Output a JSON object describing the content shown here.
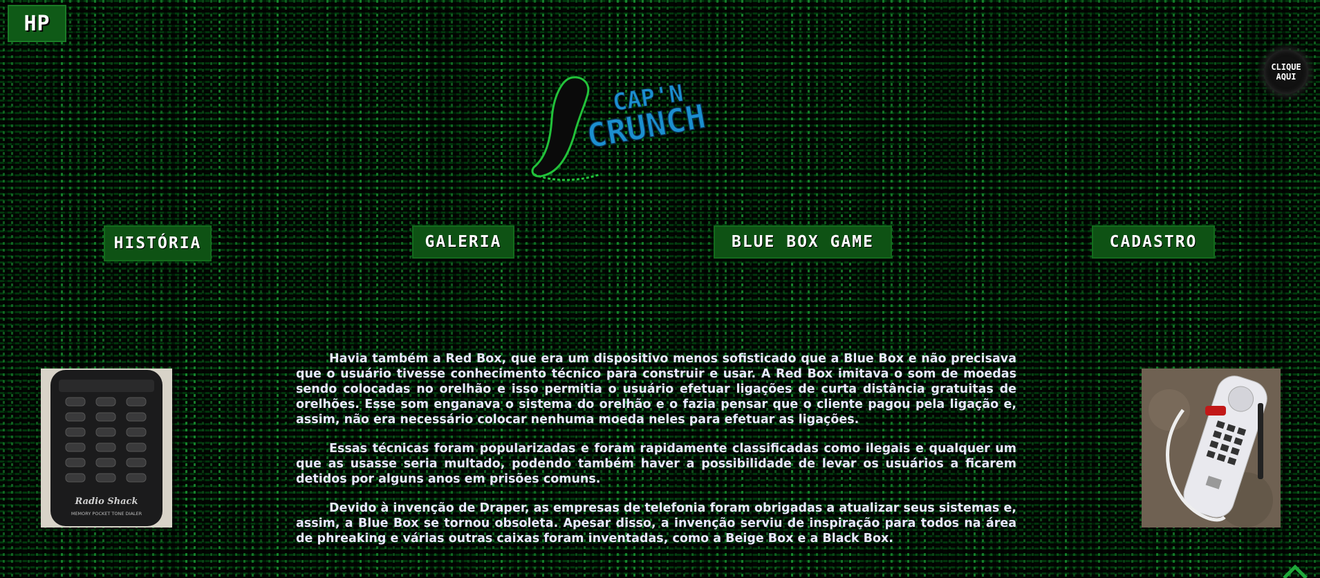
{
  "header": {
    "logo_text": "HP",
    "clique_line1": "CLIQUE",
    "clique_line2": "AQUI",
    "brand_line1": "CAP'N",
    "brand_line2": "CRUNCH"
  },
  "nav": {
    "items": [
      {
        "label": "HISTÓRIA"
      },
      {
        "label": "GALERIA"
      },
      {
        "label": "BLUE BOX GAME"
      },
      {
        "label": "CADASTRO"
      }
    ]
  },
  "main": {
    "paragraphs": [
      "Havia também a Red Box, que era um dispositivo menos sofisticado que a Blue Box e não precisava que o usuário tivesse conhecimento técnico para construir e usar. A Red Box imitava o som de moedas sendo colocadas no orelhão e isso permitia o usuário efetuar ligações de curta distância gratuitas de orelhões. Esse som enganava o sistema do orelhão e o fazia pensar que o cliente pagou pela ligação e, assim, não era necessário colocar nenhuma moeda neles para efetuar as ligações.",
      "Essas técnicas foram popularizadas e foram rapidamente classificadas como ilegais e qualquer um que as usasse seria multado, podendo também haver a possibilidade de levar os usuários a ficarem detidos por alguns anos em prisões comuns.",
      "Devido à invenção de Draper, as empresas de telefonia foram obrigadas a atualizar seus sistemas e, assim, a Blue Box se tornou obsoleta. Apesar disso, a invenção serviu de inspiração para todos na área de phreaking e várias outras caixas foram inventadas, como a Beige Box e a Black Box."
    ],
    "left_photo": {
      "brand": "Radio Shack",
      "caption": "MEMORY POCKET TONE DIALER"
    }
  },
  "colors": {
    "nav_bg": "#0e5214",
    "matrix_green": "#1fa83a",
    "brand_blue": "#1b8fcf"
  }
}
